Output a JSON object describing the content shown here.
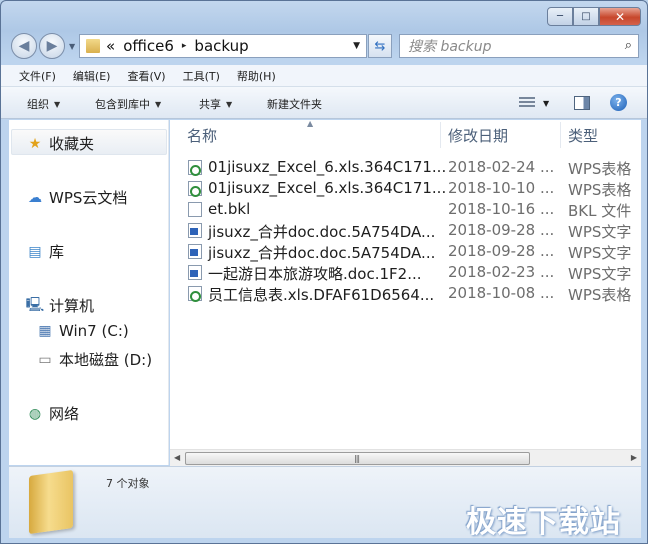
{
  "window": {
    "minimize": "─",
    "maximize": "□",
    "close": "✕"
  },
  "address": {
    "prefix": "«",
    "crumbs": [
      "office6",
      "backup"
    ],
    "separator": "▸"
  },
  "search": {
    "placeholder": "搜索 backup"
  },
  "menu": [
    "文件(F)",
    "编辑(E)",
    "查看(V)",
    "工具(T)",
    "帮助(H)"
  ],
  "toolbar": {
    "organize": "组织",
    "include_in_library": "包含到库中",
    "share": "共享",
    "new_folder": "新建文件夹"
  },
  "nav": {
    "favorites": "收藏夹",
    "wps_cloud": "WPS云文档",
    "libraries": "库",
    "computer": "计算机",
    "drive_c": "Win7 (C:)",
    "drive_d": "本地磁盘 (D:)",
    "network": "网络"
  },
  "columns": {
    "name": "名称",
    "date": "修改日期",
    "type": "类型"
  },
  "files": [
    {
      "name": "01jisuxz_Excel_6.xls.364C171...",
      "date": "2018-02-24 ...",
      "type": "WPS表格",
      "icon": "xls-icon"
    },
    {
      "name": "01jisuxz_Excel_6.xls.364C171...",
      "date": "2018-10-10 ...",
      "type": "WPS表格",
      "icon": "xls-icon"
    },
    {
      "name": "et.bkl",
      "date": "2018-10-16 ...",
      "type": "BKL 文件",
      "icon": "file-icon"
    },
    {
      "name": "jisuxz_合并doc.doc.5A754DA...",
      "date": "2018-09-28 ...",
      "type": "WPS文字",
      "icon": "doc-icon"
    },
    {
      "name": "jisuxz_合并doc.doc.5A754DA...",
      "date": "2018-09-28 ...",
      "type": "WPS文字",
      "icon": "doc-icon"
    },
    {
      "name": "一起游日本旅游攻略.doc.1F2...",
      "date": "2018-02-23 ...",
      "type": "WPS文字",
      "icon": "doc-icon"
    },
    {
      "name": "员工信息表.xls.DFAF61D6564...",
      "date": "2018-10-08 ...",
      "type": "WPS表格",
      "icon": "xls-icon"
    }
  ],
  "status": {
    "count": "7 个对象"
  },
  "watermark": "极速下载站"
}
